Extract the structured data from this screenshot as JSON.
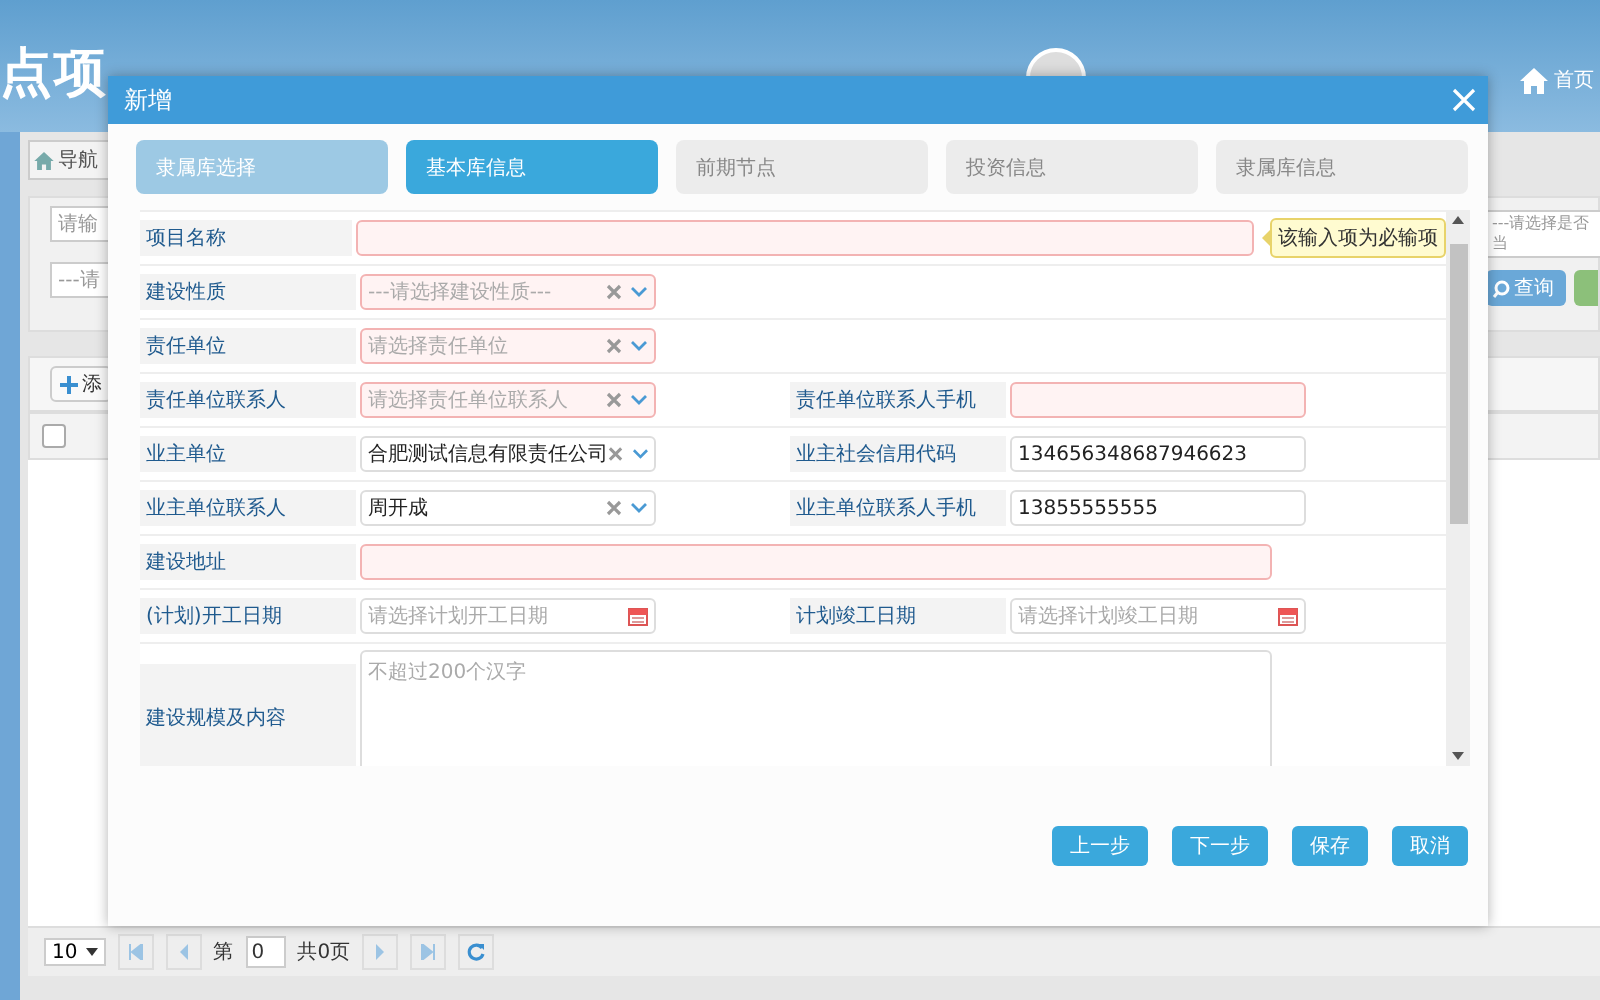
{
  "header": {
    "title": "点项",
    "home": "首页"
  },
  "background": {
    "nav_tab": "导航",
    "search_placeholder": "请输",
    "select_placeholder": "---请",
    "add_button": "添",
    "select_all_checked": false,
    "right_select_placeholder": "---请选择是否当",
    "query_button": "查询",
    "pagination": {
      "page_size": "10",
      "page_label": "第",
      "page": "0",
      "total": "共0页"
    }
  },
  "dialog": {
    "title": "新增",
    "steps": [
      {
        "label": "隶属库选择",
        "selected": false,
        "done": true
      },
      {
        "label": "基本库信息",
        "selected": true
      },
      {
        "label": "前期节点",
        "selected": false,
        "done": false
      },
      {
        "label": "投资信息",
        "selected": false,
        "done": false
      },
      {
        "label": "隶属库信息",
        "selected": false,
        "done": false
      }
    ],
    "rows": [
      [
        {
          "label": "项目名称",
          "kind": "text",
          "required": true,
          "wide": true,
          "tooltip": "该输入项为必输项"
        }
      ],
      [
        {
          "label": "建设性质",
          "kind": "select",
          "required": true,
          "wide": false,
          "placeholder": "---请选择建设性质---"
        }
      ],
      [
        {
          "label": "责任单位",
          "kind": "select",
          "required": true,
          "wide": false,
          "placeholder": "请选择责任单位"
        }
      ],
      [
        {
          "label": "责任单位联系人",
          "kind": "select",
          "required": true,
          "wide": false,
          "placeholder": "请选择责任单位联系人"
        },
        {
          "label": "责任单位联系人手机",
          "kind": "text",
          "required": true,
          "wide": false
        }
      ],
      [
        {
          "label": "业主单位",
          "kind": "select",
          "required": false,
          "wide": false,
          "value": "合肥测试信息有限责任公司"
        },
        {
          "label": "业主社会信用代码",
          "kind": "text",
          "required": false,
          "wide": false,
          "value": "134656348687946623"
        }
      ],
      [
        {
          "label": "业主单位联系人",
          "kind": "select",
          "required": false,
          "wide": false,
          "value": "周开成"
        },
        {
          "label": "业主单位联系人手机",
          "kind": "text",
          "required": false,
          "wide": false,
          "value": "13855555555"
        }
      ],
      [
        {
          "label": "建设地址",
          "kind": "text",
          "required": true,
          "wide": true
        }
      ],
      [
        {
          "label": "(计划)开工日期",
          "kind": "date",
          "required": false,
          "wide": false,
          "placeholder": "请选择计划开工日期"
        },
        {
          "label": "计划竣工日期",
          "kind": "date",
          "required": false,
          "wide": false,
          "placeholder": "请选择计划竣工日期"
        }
      ],
      [
        {
          "label": "建设规模及内容",
          "kind": "textarea",
          "required": false,
          "wide": true,
          "placeholder": "不超过200个汉字"
        }
      ]
    ],
    "buttons": [
      "上一步",
      "下一步",
      "保存",
      "取消"
    ]
  }
}
